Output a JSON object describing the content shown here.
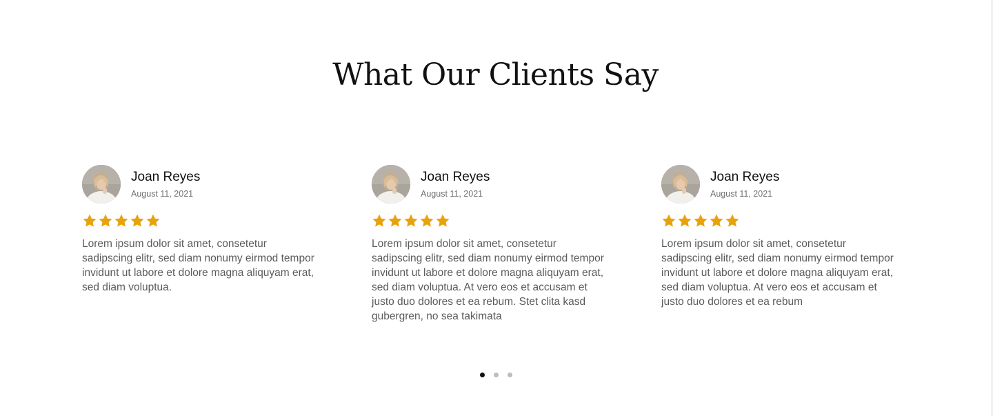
{
  "section": {
    "title": "What Our Clients Say"
  },
  "colors": {
    "star": "#E8A20C",
    "dot_active": "#111111",
    "dot_inactive": "#BDBDBD"
  },
  "testimonials": [
    {
      "name": "Joan Reyes",
      "date": "August 11, 2021",
      "rating": 5,
      "text": "Lorem ipsum dolor sit amet, consetetur sadipscing elitr, sed diam nonumy eirmod tempor invidunt ut labore et dolore magna aliquyam erat, sed diam voluptua."
    },
    {
      "name": "Joan Reyes",
      "date": "August 11, 2021",
      "rating": 5,
      "text": "Lorem ipsum dolor sit amet, consetetur sadipscing elitr, sed diam nonumy eirmod tempor invidunt ut labore et dolore magna aliquyam erat, sed diam voluptua. At vero eos et accusam et justo duo dolores et ea rebum. Stet clita kasd gubergren, no sea takimata"
    },
    {
      "name": "Joan Reyes",
      "date": "August 11, 2021",
      "rating": 5,
      "text": "Lorem ipsum dolor sit amet, consetetur sadipscing elitr, sed diam nonumy eirmod tempor invidunt ut labore et dolore magna aliquyam erat, sed diam voluptua. At vero eos et accusam et justo duo dolores et ea rebum"
    }
  ],
  "pagination": {
    "page_count": 3,
    "active_page": 1
  }
}
